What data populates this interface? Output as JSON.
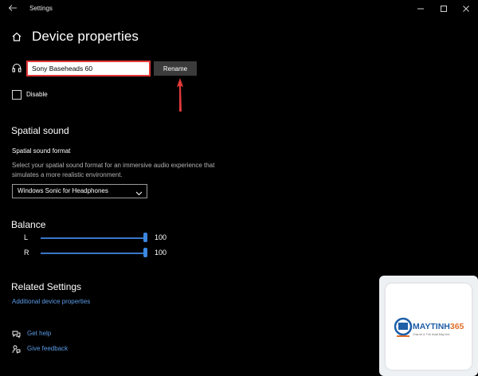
{
  "window": {
    "title": "Settings"
  },
  "page": {
    "title": "Device properties"
  },
  "device": {
    "name_value": "Sony Baseheads 60",
    "rename_label": "Rename",
    "disable_label": "Disable"
  },
  "spatial": {
    "title": "Spatial sound",
    "format_label": "Spatial sound format",
    "description": "Select your spatial sound format for an immersive audio experience that simulates a more realistic environment.",
    "selected": "Windows Sonic for Headphones"
  },
  "balance": {
    "title": "Balance",
    "channels": [
      {
        "label": "L",
        "value": "100",
        "level": 1.0
      },
      {
        "label": "R",
        "value": "100",
        "level": 1.0
      }
    ]
  },
  "related": {
    "title": "Related Settings",
    "link": "Additional device properties"
  },
  "help": {
    "get_help": "Get help",
    "feedback": "Give feedback"
  },
  "watermark": {
    "brand": "MAYTINH365",
    "tagline": "Chia sẻ & Thủ thuật Máy tính"
  },
  "colors": {
    "accent": "#3a86e0",
    "link": "#5a9be6",
    "annotation": "#e33a3a",
    "background": "#000000"
  }
}
